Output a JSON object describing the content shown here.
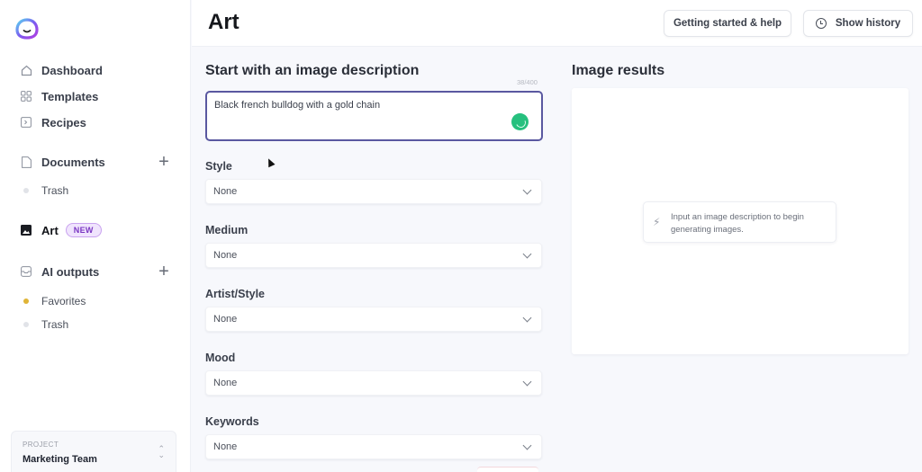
{
  "sidebar": {
    "nav": [
      {
        "label": "Dashboard",
        "icon": "home-icon"
      },
      {
        "label": "Templates",
        "icon": "grid-icon"
      },
      {
        "label": "Recipes",
        "icon": "recipe-icon"
      }
    ],
    "documents": {
      "label": "Documents",
      "icon": "document-icon",
      "children": [
        {
          "label": "Trash"
        }
      ]
    },
    "art": {
      "label": "Art",
      "icon": "image-icon",
      "badge": "NEW"
    },
    "ai_outputs": {
      "label": "AI outputs",
      "icon": "inbox-icon",
      "children": [
        {
          "label": "Favorites"
        },
        {
          "label": "Trash"
        }
      ]
    },
    "project": {
      "label": "PROJECT",
      "name": "Marketing Team"
    }
  },
  "header": {
    "title": "Art",
    "help_button": "Getting started & help",
    "history_button": "Show history"
  },
  "form": {
    "title": "Start with an image description",
    "counter": "38/400",
    "prompt_value": "Black french bulldog with a gold chain",
    "fields": [
      {
        "label": "Style",
        "value": "None"
      },
      {
        "label": "Medium",
        "value": "None"
      },
      {
        "label": "Artist/Style",
        "value": "None"
      },
      {
        "label": "Mood",
        "value": "None"
      },
      {
        "label": "Keywords",
        "value": "None"
      }
    ]
  },
  "results": {
    "title": "Image results",
    "hint": "Input an image description to begin generating images."
  },
  "colors": {
    "accent": "#5a58a0",
    "spinner": "#26c07e",
    "badge": "#7a36c2",
    "favorite_dot": "#e0b437"
  }
}
